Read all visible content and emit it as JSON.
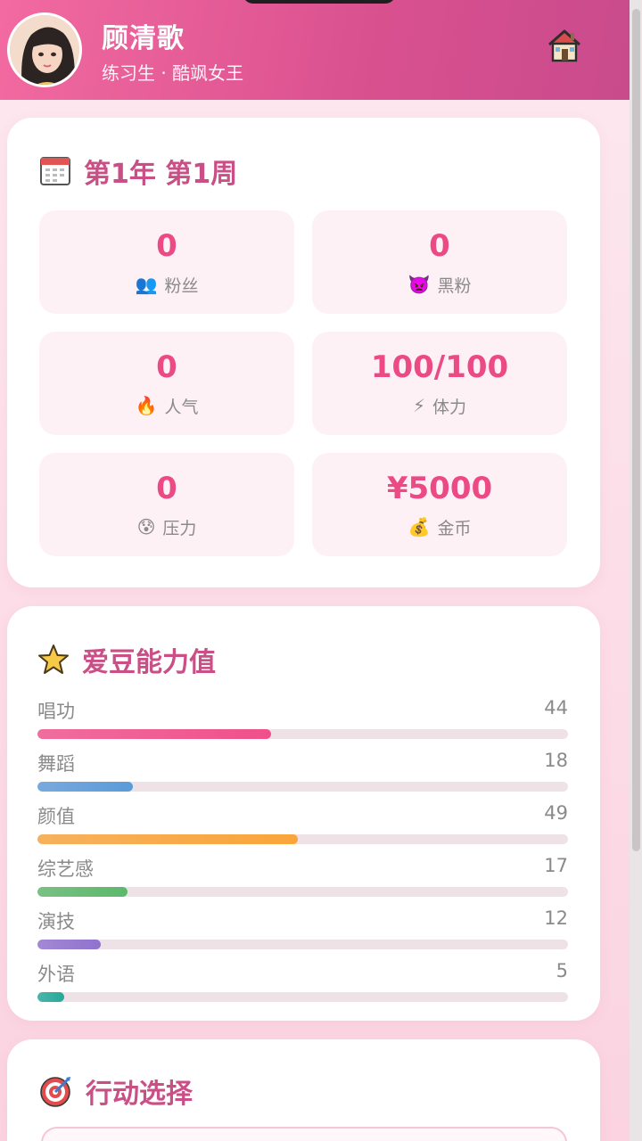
{
  "profile": {
    "name": "顾清歌",
    "subtitle": "练习生 · 酷飒女王"
  },
  "icons": {
    "home": "house-icon",
    "calendar": "calendar-icon",
    "star": "star-icon",
    "target": "target-icon"
  },
  "week_card": {
    "title": "第1年 第1周",
    "stats": [
      {
        "value": "0",
        "label": "粉丝",
        "icon": "👥",
        "icon_name": "fans-icon"
      },
      {
        "value": "0",
        "label": "黑粉",
        "icon": "👿",
        "icon_name": "devil-icon"
      },
      {
        "value": "0",
        "label": "人气",
        "icon": "🔥",
        "icon_name": "fire-icon"
      },
      {
        "value": "100/100",
        "label": "体力",
        "icon": "⚡",
        "icon_name": "lightning-icon"
      },
      {
        "value": "0",
        "label": "压力",
        "icon": "😰",
        "icon_name": "anxious-face-icon"
      },
      {
        "value": "¥5000",
        "label": "金币",
        "icon": "💰",
        "icon_name": "money-bag-icon"
      }
    ]
  },
  "ability_card": {
    "title": "爱豆能力值",
    "max": 100,
    "abilities": [
      {
        "label": "唱功",
        "value": 44,
        "color": "#f0508a"
      },
      {
        "label": "舞蹈",
        "value": 18,
        "color": "#5b9bd9"
      },
      {
        "label": "颜值",
        "value": 49,
        "color": "#f9a53a"
      },
      {
        "label": "综艺感",
        "value": 17,
        "color": "#5cb86b"
      },
      {
        "label": "演技",
        "value": 12,
        "color": "#8f72cf"
      },
      {
        "label": "外语",
        "value": 5,
        "color": "#23a99b"
      }
    ]
  },
  "action_card": {
    "title": "行动选择"
  },
  "colors": {
    "accent": "#ec4a85",
    "title": "#c94f86",
    "header_start": "#f26aa0",
    "header_end": "#c94b8c"
  }
}
